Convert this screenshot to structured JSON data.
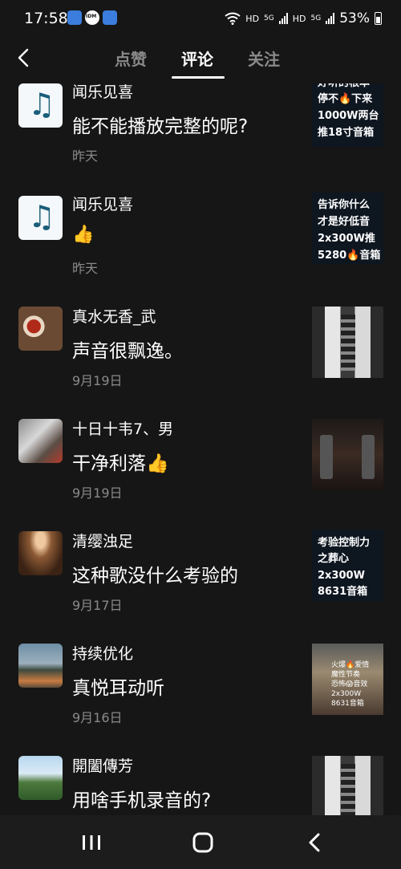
{
  "status": {
    "time": "17:58",
    "net_1": "HD",
    "net_2": "HD",
    "sig_1": "5G",
    "sig_2": "5G",
    "battery": "53%"
  },
  "header": {
    "tabs": [
      {
        "label": "点赞"
      },
      {
        "label": "评论"
      },
      {
        "label": "关注"
      }
    ],
    "active_tab": "评论"
  },
  "comments": [
    {
      "username": "闻乐见喜",
      "text": "能不能播放完整的呢?",
      "date": "昨天",
      "avatar": "music-note",
      "thumb_lines": [
        "好听的根本",
        "停不🔥下来",
        "1000W两台",
        "推18寸音箱"
      ]
    },
    {
      "username": "闻乐见喜",
      "text": "👍",
      "date": "昨天",
      "avatar": "music-note",
      "thumb_lines": [
        "告诉你什么",
        "才是好低音",
        "2x300W推",
        "5280🔥音箱"
      ]
    },
    {
      "username": "真水无香_武",
      "text": "声音很飘逸。",
      "date": "9月19日",
      "avatar": "tea-set",
      "thumb_lines": []
    },
    {
      "username": "十日十韦7、男",
      "text": "干净利落👍",
      "date": "9月19日",
      "avatar": "shop",
      "thumb_lines": []
    },
    {
      "username": "清缨浊足",
      "text": "这种歌没什么考验的",
      "date": "9月17日",
      "avatar": "concert-hall",
      "thumb_lines": [
        "考验控制力",
        "之葬心",
        "2x300W",
        "8631音箱"
      ]
    },
    {
      "username": "持续优化",
      "text": "真悦耳动听",
      "date": "9月16日",
      "avatar": "city-view",
      "thumb_lines": [
        "火爆🔥爱情",
        "魔性节奏",
        "恐怖😱音效",
        "2x300W",
        "8631音箱"
      ]
    },
    {
      "username": "開闔傳芳",
      "text": "用啥手机录音的?",
      "date": "",
      "avatar": "hill-landscape",
      "thumb_lines": []
    }
  ],
  "colors": {
    "background": "#161616",
    "text_primary": "#ffffff",
    "text_secondary": "#8a8a8a",
    "navbar": "#1c1c1c"
  }
}
